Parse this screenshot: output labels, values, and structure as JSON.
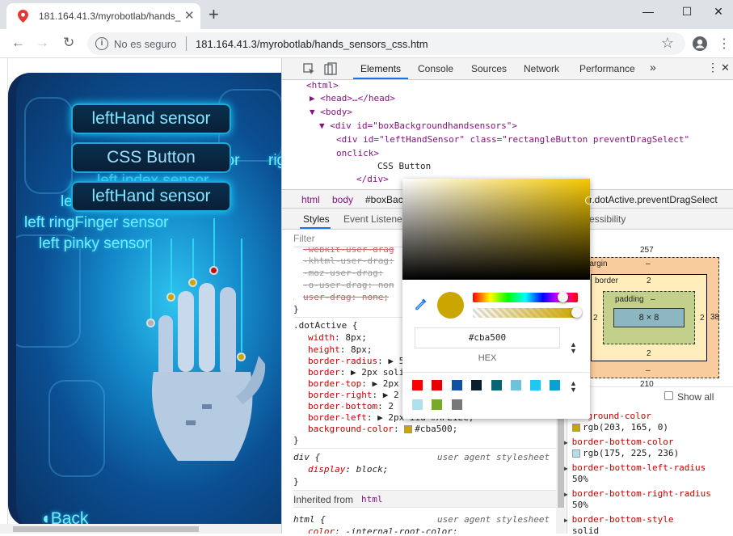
{
  "browser": {
    "tab_title": "181.164.41.3/myrobotlab/hands_",
    "tab_close": "✕",
    "new_tab": "+",
    "window": {
      "minimize": "—",
      "maximize": "☐",
      "close": "✕"
    },
    "nav": {
      "back": "←",
      "forward": "→",
      "reload": "↻"
    },
    "omnibox": {
      "security_label": "No es seguro",
      "url": "181.164.41.3/myrobotlab/hands_sensors_css.htm",
      "star": "☆"
    },
    "profile_icon": "account-circle-icon",
    "menu": "⋮"
  },
  "page": {
    "buttons": {
      "top": "leftHand sensor",
      "middle": "CSS Button",
      "bottom": "leftHand sensor"
    },
    "sensor_labels": [
      "sor",
      "rig",
      "left index sensor",
      "le",
      "left ringFinger sensor",
      "left pinky sensor"
    ],
    "back": "Back"
  },
  "devtools": {
    "tabs": [
      "Elements",
      "Console",
      "Sources",
      "Network",
      "Performance"
    ],
    "more_tabs": "»",
    "active_tab": "Elements",
    "dom_lines": [
      {
        "text": "<html>"
      },
      {
        "text": "▶ <head>…</head>"
      },
      {
        "text": "▼ <body>"
      },
      {
        "text": "▼ <div id=\"boxBackgroundhandsensors\">"
      },
      {
        "text": "<div id=\"leftHandSensor\" class=\"rectangleButton preventDragSelect\""
      },
      {
        "text": "onclick>"
      },
      {
        "text": "CSS Button"
      },
      {
        "text": "</div>"
      }
    ],
    "breadcrumbs": [
      "html",
      "body",
      "#boxBack",
      "r.dotActive.preventDragSelect"
    ],
    "subtabs": {
      "styles": "Styles",
      "event_listeners": "Event Listene",
      "accessibility": "essibility"
    },
    "filter_placeholder": "Filter",
    "struck_props": [
      "-webkit-user-drag",
      "-khtml-user-drag:",
      "-moz-user-drag:",
      "-o-user-drag: non",
      "user-drag: none;"
    ],
    "rule_close": "}",
    "dot_active": {
      "selector": ".dotActive {",
      "props": [
        {
          "name": "width",
          "value": "8px;"
        },
        {
          "name": "height",
          "value": "8px;"
        },
        {
          "name": "border-radius",
          "value": "▶ 5"
        },
        {
          "name": "border",
          "value": "▶ 2px soli"
        },
        {
          "name": "border-top",
          "value": "▶ 2px"
        },
        {
          "name": "border-right",
          "value": "▶ 2"
        },
        {
          "name": "border-bottom",
          "value": "2"
        },
        {
          "name": "border-left",
          "value": "▶ 2px"
        },
        {
          "name": "background-color",
          "value": "#cba500;"
        }
      ],
      "border_left_color": "#AFE1EC",
      "extra_frag": "iid #AFE1EC;"
    },
    "div_rule": {
      "selector": "div {",
      "source": "user agent stylesheet",
      "prop": "display",
      "value": "block;"
    },
    "inherited": {
      "label": "Inherited from",
      "from": "html"
    },
    "html_rule": {
      "selector": "html {",
      "source": "user agent stylesheet",
      "prop": "color",
      "value": "-internal-root-color;"
    },
    "box_model": {
      "position_label": "on",
      "position_value": "257",
      "margin_label": "margin",
      "margin_value": "–",
      "border_label": "border",
      "border_value": "2",
      "padding_label": "padding",
      "padding_value": "–",
      "content": "8 × 8",
      "side_left": "2",
      "side_right": "2",
      "side_outer_left": "2",
      "side_outer_right": "38",
      "bottom_value": "2",
      "margin_bottom": "–",
      "footer_value": "210"
    },
    "computed": {
      "filter_placeholder": "er",
      "show_all": "Show all",
      "props": [
        {
          "name": "background-color",
          "value": "rgb(203, 165, 0)",
          "swatch": "#cba500"
        },
        {
          "name": "border-bottom-color",
          "value": "rgb(175, 225, 236)",
          "swatch": "#afe1ec"
        },
        {
          "name": "border-bottom-left-radius",
          "value": "50%"
        },
        {
          "name": "border-bottom-right-radius",
          "value": "50%"
        },
        {
          "name": "border-bottom-style",
          "value": "solid"
        }
      ]
    }
  },
  "color_picker": {
    "hex_value": "#cba500",
    "format_label": "HEX",
    "current_color": "#cba500",
    "palette": [
      "#ff0000",
      "#e60000",
      "#1450a0",
      "#0a1e2e",
      "#0a6478",
      "#6ec3dc",
      "#1ec8f0",
      "#0aa0d2",
      "#afe1ec",
      "#78aa28",
      "#787878"
    ]
  }
}
